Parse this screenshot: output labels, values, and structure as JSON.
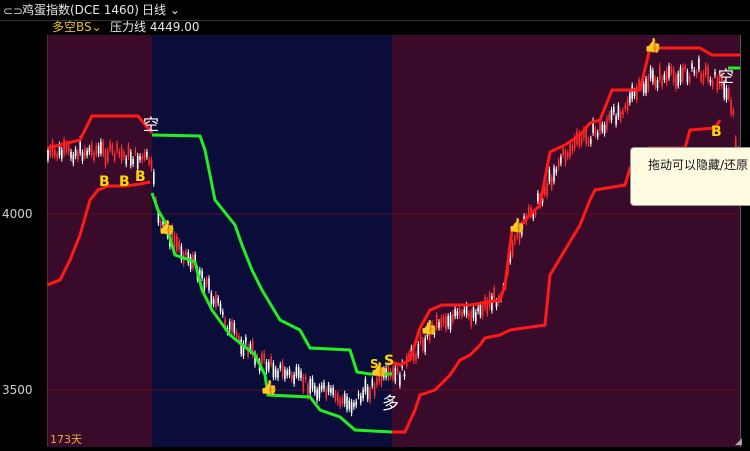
{
  "titlebar": {
    "icon": "split-window-icon",
    "title": "鸡蛋指数(DCE 1460)",
    "period": "日线"
  },
  "subbar": {
    "indicator": "多空BS",
    "pressure_label": "压力线",
    "pressure_value": "4449.00"
  },
  "yaxis": {
    "ticks": [
      "4000",
      "3500"
    ]
  },
  "days_label": "173天",
  "tooltip": "拖动可以隐藏/还原",
  "colors": {
    "red_line": "#ff1a1a",
    "green_line": "#22ee22",
    "bull_bg": "#3a0a2a",
    "bear_bg": "#0a0c3a",
    "signal": "#ffd700"
  },
  "chart_data": {
    "type": "candlestick-with-bands",
    "signals": [
      {
        "text": "B"
      },
      {
        "text": "B"
      },
      {
        "text": "B"
      },
      {
        "text": "空"
      },
      {
        "text": "S"
      },
      {
        "text": "S"
      },
      {
        "text": "多"
      },
      {
        "text": "空"
      },
      {
        "text": "B"
      }
    ]
  }
}
